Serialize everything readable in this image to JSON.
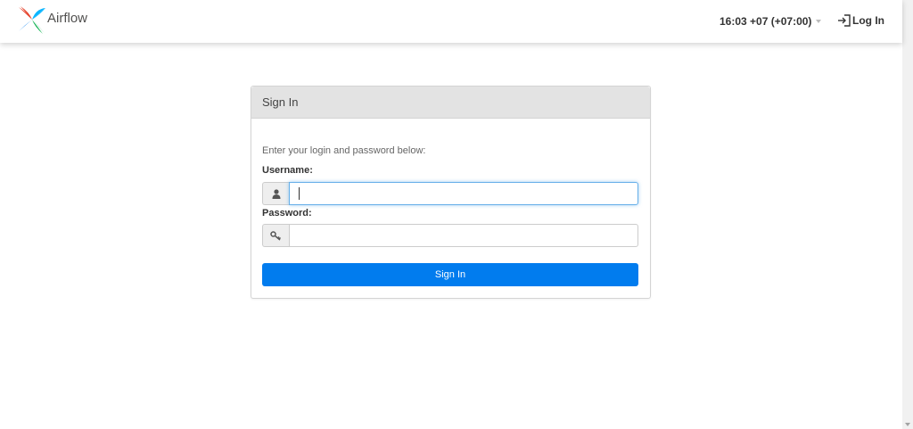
{
  "app": {
    "brand_name": "Airflow"
  },
  "navbar": {
    "timezone": "16:03 +07 (+07:00)",
    "login_label": "Log In"
  },
  "panel": {
    "title": "Sign In",
    "intro": "Enter your login and password below:",
    "username_label": "Username:",
    "username_value": "",
    "password_label": "Password:",
    "password_value": "",
    "submit_label": "Sign In"
  },
  "colors": {
    "accent": "#017cee",
    "panel_heading": "#e3e3e3",
    "focus_border": "#66afe9"
  },
  "icons": [
    "airflow-logo",
    "user-icon",
    "key-icon",
    "login-icon"
  ]
}
